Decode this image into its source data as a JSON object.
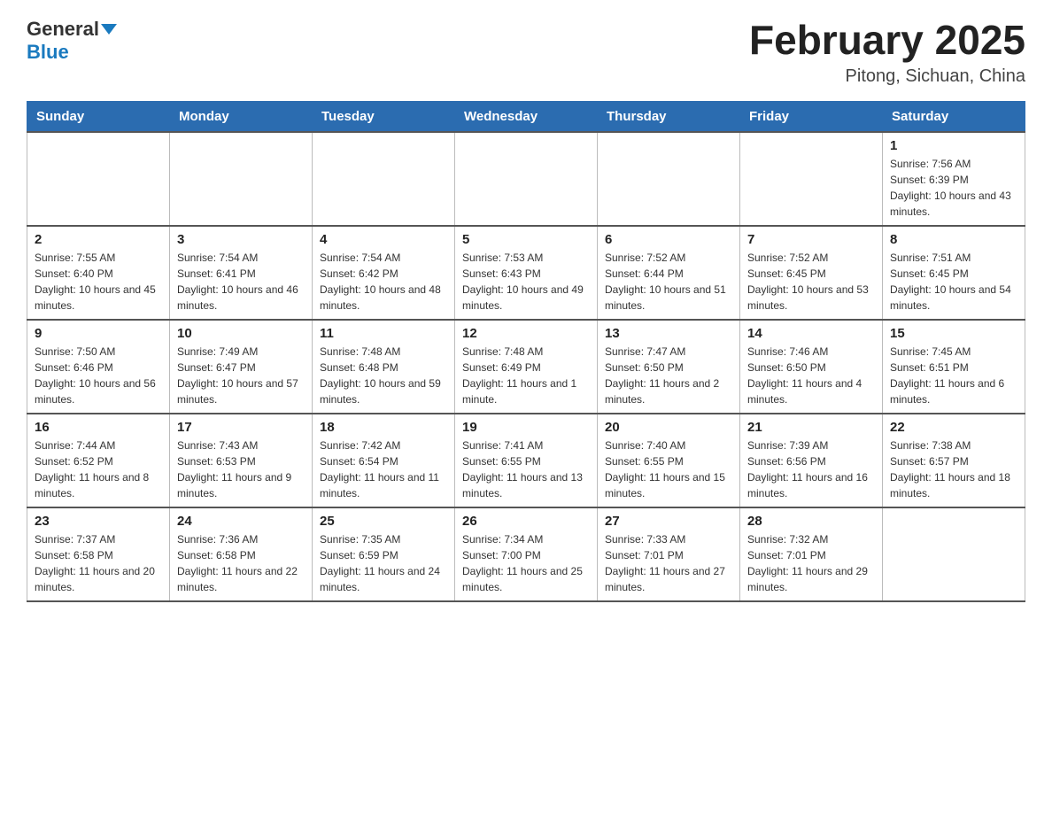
{
  "header": {
    "logo_general": "General",
    "logo_blue": "Blue",
    "month_title": "February 2025",
    "location": "Pitong, Sichuan, China"
  },
  "days_of_week": [
    "Sunday",
    "Monday",
    "Tuesday",
    "Wednesday",
    "Thursday",
    "Friday",
    "Saturday"
  ],
  "weeks": [
    [
      {
        "day": "",
        "info": ""
      },
      {
        "day": "",
        "info": ""
      },
      {
        "day": "",
        "info": ""
      },
      {
        "day": "",
        "info": ""
      },
      {
        "day": "",
        "info": ""
      },
      {
        "day": "",
        "info": ""
      },
      {
        "day": "1",
        "info": "Sunrise: 7:56 AM\nSunset: 6:39 PM\nDaylight: 10 hours and 43 minutes."
      }
    ],
    [
      {
        "day": "2",
        "info": "Sunrise: 7:55 AM\nSunset: 6:40 PM\nDaylight: 10 hours and 45 minutes."
      },
      {
        "day": "3",
        "info": "Sunrise: 7:54 AM\nSunset: 6:41 PM\nDaylight: 10 hours and 46 minutes."
      },
      {
        "day": "4",
        "info": "Sunrise: 7:54 AM\nSunset: 6:42 PM\nDaylight: 10 hours and 48 minutes."
      },
      {
        "day": "5",
        "info": "Sunrise: 7:53 AM\nSunset: 6:43 PM\nDaylight: 10 hours and 49 minutes."
      },
      {
        "day": "6",
        "info": "Sunrise: 7:52 AM\nSunset: 6:44 PM\nDaylight: 10 hours and 51 minutes."
      },
      {
        "day": "7",
        "info": "Sunrise: 7:52 AM\nSunset: 6:45 PM\nDaylight: 10 hours and 53 minutes."
      },
      {
        "day": "8",
        "info": "Sunrise: 7:51 AM\nSunset: 6:45 PM\nDaylight: 10 hours and 54 minutes."
      }
    ],
    [
      {
        "day": "9",
        "info": "Sunrise: 7:50 AM\nSunset: 6:46 PM\nDaylight: 10 hours and 56 minutes."
      },
      {
        "day": "10",
        "info": "Sunrise: 7:49 AM\nSunset: 6:47 PM\nDaylight: 10 hours and 57 minutes."
      },
      {
        "day": "11",
        "info": "Sunrise: 7:48 AM\nSunset: 6:48 PM\nDaylight: 10 hours and 59 minutes."
      },
      {
        "day": "12",
        "info": "Sunrise: 7:48 AM\nSunset: 6:49 PM\nDaylight: 11 hours and 1 minute."
      },
      {
        "day": "13",
        "info": "Sunrise: 7:47 AM\nSunset: 6:50 PM\nDaylight: 11 hours and 2 minutes."
      },
      {
        "day": "14",
        "info": "Sunrise: 7:46 AM\nSunset: 6:50 PM\nDaylight: 11 hours and 4 minutes."
      },
      {
        "day": "15",
        "info": "Sunrise: 7:45 AM\nSunset: 6:51 PM\nDaylight: 11 hours and 6 minutes."
      }
    ],
    [
      {
        "day": "16",
        "info": "Sunrise: 7:44 AM\nSunset: 6:52 PM\nDaylight: 11 hours and 8 minutes."
      },
      {
        "day": "17",
        "info": "Sunrise: 7:43 AM\nSunset: 6:53 PM\nDaylight: 11 hours and 9 minutes."
      },
      {
        "day": "18",
        "info": "Sunrise: 7:42 AM\nSunset: 6:54 PM\nDaylight: 11 hours and 11 minutes."
      },
      {
        "day": "19",
        "info": "Sunrise: 7:41 AM\nSunset: 6:55 PM\nDaylight: 11 hours and 13 minutes."
      },
      {
        "day": "20",
        "info": "Sunrise: 7:40 AM\nSunset: 6:55 PM\nDaylight: 11 hours and 15 minutes."
      },
      {
        "day": "21",
        "info": "Sunrise: 7:39 AM\nSunset: 6:56 PM\nDaylight: 11 hours and 16 minutes."
      },
      {
        "day": "22",
        "info": "Sunrise: 7:38 AM\nSunset: 6:57 PM\nDaylight: 11 hours and 18 minutes."
      }
    ],
    [
      {
        "day": "23",
        "info": "Sunrise: 7:37 AM\nSunset: 6:58 PM\nDaylight: 11 hours and 20 minutes."
      },
      {
        "day": "24",
        "info": "Sunrise: 7:36 AM\nSunset: 6:58 PM\nDaylight: 11 hours and 22 minutes."
      },
      {
        "day": "25",
        "info": "Sunrise: 7:35 AM\nSunset: 6:59 PM\nDaylight: 11 hours and 24 minutes."
      },
      {
        "day": "26",
        "info": "Sunrise: 7:34 AM\nSunset: 7:00 PM\nDaylight: 11 hours and 25 minutes."
      },
      {
        "day": "27",
        "info": "Sunrise: 7:33 AM\nSunset: 7:01 PM\nDaylight: 11 hours and 27 minutes."
      },
      {
        "day": "28",
        "info": "Sunrise: 7:32 AM\nSunset: 7:01 PM\nDaylight: 11 hours and 29 minutes."
      },
      {
        "day": "",
        "info": ""
      }
    ]
  ]
}
